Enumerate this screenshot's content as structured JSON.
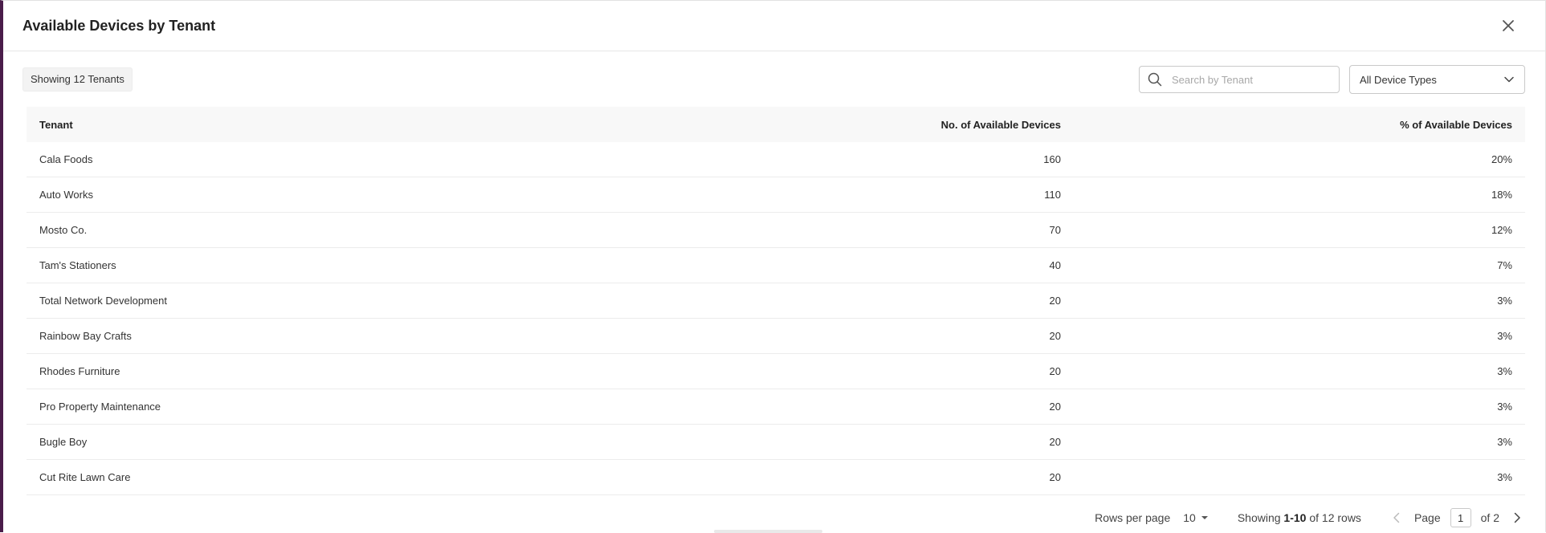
{
  "header": {
    "title": "Available Devices by Tenant"
  },
  "toolbar": {
    "count_label": "Showing 12 Tenants",
    "search_placeholder": "Search by Tenant",
    "device_type_selected": "All Device Types"
  },
  "table": {
    "columns": [
      "Tenant",
      "No. of Available Devices",
      "% of Available Devices"
    ],
    "rows": [
      {
        "tenant": "Cala Foods",
        "devices": "160",
        "percent": "20%"
      },
      {
        "tenant": "Auto Works",
        "devices": "110",
        "percent": "18%"
      },
      {
        "tenant": "Mosto Co.",
        "devices": "70",
        "percent": "12%"
      },
      {
        "tenant": "Tam's Stationers",
        "devices": "40",
        "percent": "7%"
      },
      {
        "tenant": "Total Network Development",
        "devices": "20",
        "percent": "3%"
      },
      {
        "tenant": "Rainbow Bay Crafts",
        "devices": "20",
        "percent": "3%"
      },
      {
        "tenant": "Rhodes Furniture",
        "devices": "20",
        "percent": "3%"
      },
      {
        "tenant": "Pro Property Maintenance",
        "devices": "20",
        "percent": "3%"
      },
      {
        "tenant": "Bugle Boy",
        "devices": "20",
        "percent": "3%"
      },
      {
        "tenant": "Cut Rite Lawn Care",
        "devices": "20",
        "percent": "3%"
      }
    ]
  },
  "footer": {
    "rows_per_page_label": "Rows per page",
    "rows_per_page_value": "10",
    "showing_prefix": "Showing",
    "showing_range": "1-10",
    "showing_suffix": "of 12 rows",
    "page_label": "Page",
    "page_value": "1",
    "page_total": "of 2"
  },
  "colors": {
    "accent_border": "#4a1d4a",
    "header_bg": "#f8f8f8"
  },
  "icons": {
    "close": "close-icon",
    "search": "search-icon",
    "dropdown": "chevron-down-icon",
    "prev": "chevron-left-icon",
    "next": "chevron-right-icon"
  }
}
